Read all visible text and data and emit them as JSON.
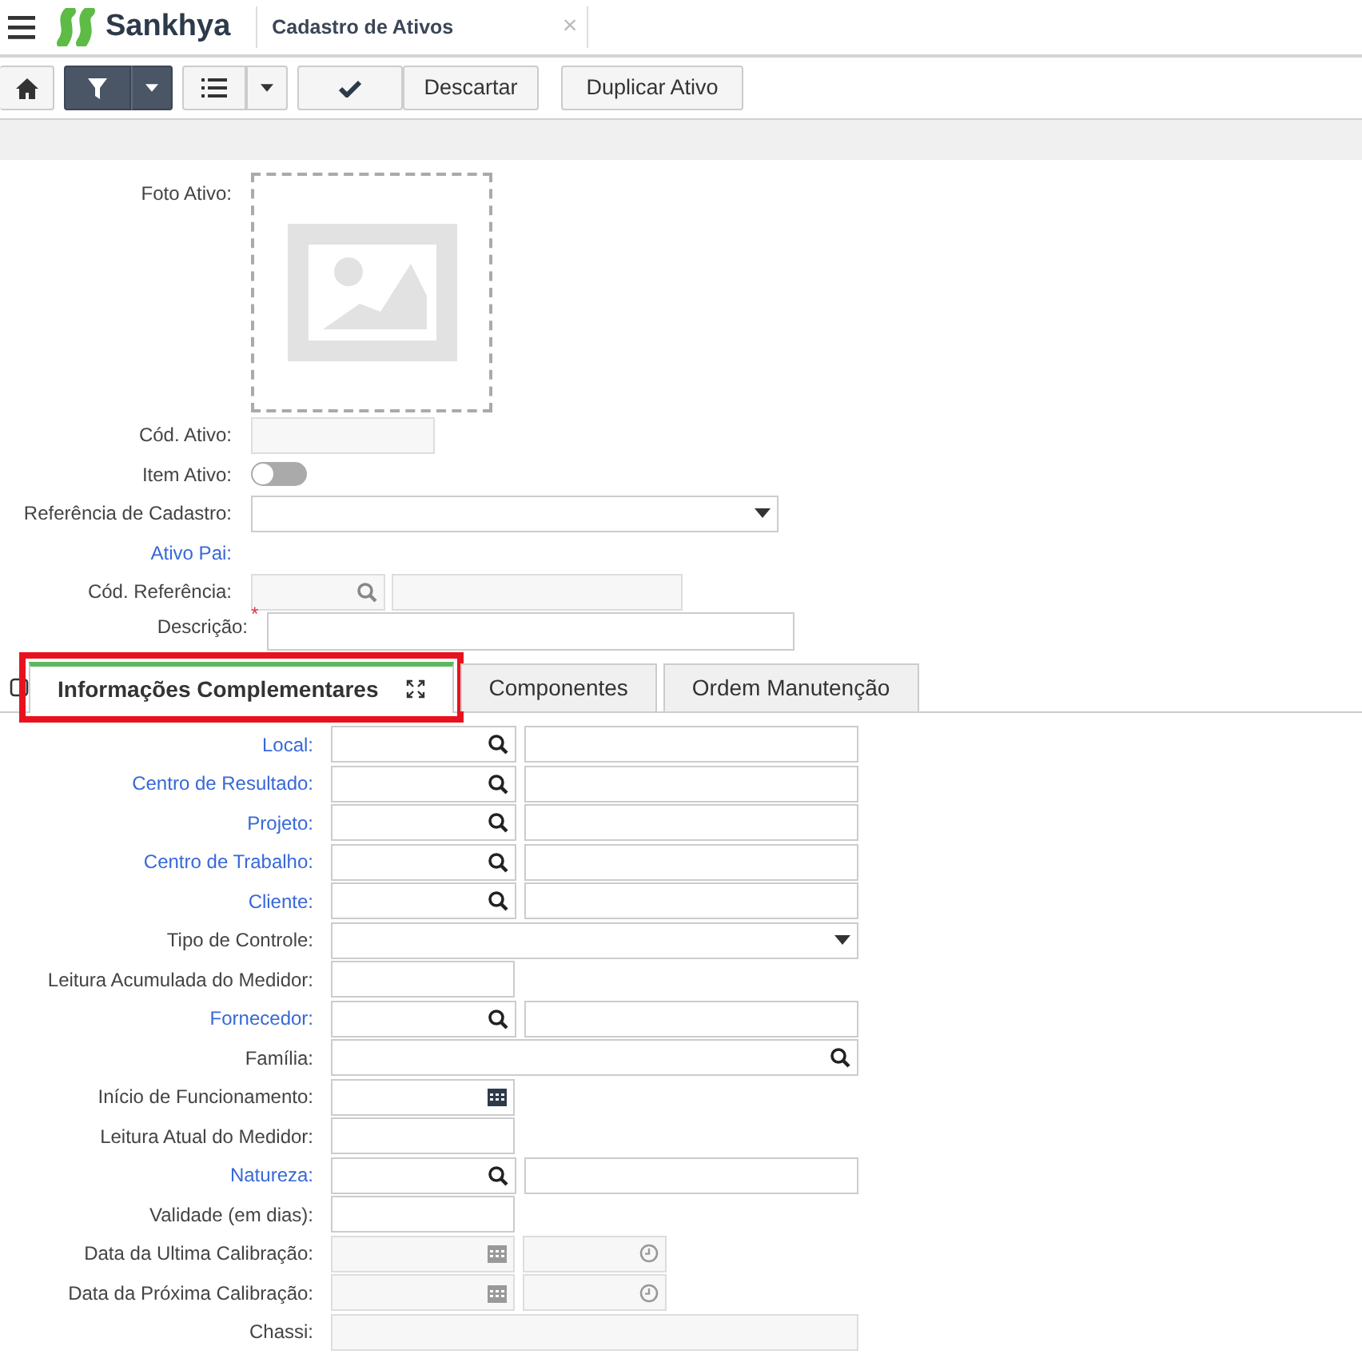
{
  "header": {
    "brand": "Sankhya",
    "tab_title": "Cadastro de Ativos",
    "close": "×"
  },
  "toolbar": {
    "buttons": [
      {
        "kind": "home"
      },
      {
        "kind": "filter",
        "dark": true
      },
      {
        "kind": "list",
        "dark": false
      },
      {
        "kind": "confirm",
        "label": "Descartar"
      },
      {
        "kind": "text",
        "label": "Duplicar Ativo"
      }
    ]
  },
  "top_fields": [
    {
      "kind": "photo",
      "label": "Foto Ativo:"
    },
    {
      "kind": "text",
      "label": "Cód. Ativo:",
      "disabled": true
    },
    {
      "kind": "switch",
      "label": "Item Ativo:",
      "on": false
    },
    {
      "kind": "select",
      "label": "Referência de Cadastro:"
    },
    {
      "kind": "heading",
      "label": "Ativo Pai:",
      "link": true
    },
    {
      "kind": "lookup",
      "label": "Cód. Referência:",
      "disabled": true
    },
    {
      "kind": "textarea",
      "label": "Descrição:",
      "required": true,
      "required_mark": "*"
    }
  ],
  "tabs": [
    {
      "label": "Informações Complementares",
      "selected": true,
      "highlighted": true
    },
    {
      "label": "Componentes",
      "selected": false,
      "highlighted": false
    },
    {
      "label": "Ordem Manutenção",
      "selected": false,
      "highlighted": false
    }
  ],
  "fields": [
    {
      "kind": "lookup",
      "label": "Local:",
      "link": true,
      "disabled": false
    },
    {
      "kind": "lookup",
      "label": "Centro de Resultado:",
      "link": true,
      "disabled": false
    },
    {
      "kind": "lookup",
      "label": "Projeto:",
      "link": true,
      "disabled": false
    },
    {
      "kind": "lookup",
      "label": "Centro de Trabalho:",
      "link": true,
      "disabled": false
    },
    {
      "kind": "lookup",
      "label": "Cliente:",
      "link": true,
      "disabled": false
    },
    {
      "kind": "select",
      "label": "Tipo de Controle:",
      "link": false,
      "disabled": false
    },
    {
      "kind": "text",
      "label": "Leitura Acumulada do Medidor:",
      "link": false,
      "disabled": false
    },
    {
      "kind": "lookup",
      "label": "Fornecedor:",
      "link": true,
      "disabled": false
    },
    {
      "kind": "search",
      "label": "Família:",
      "link": false,
      "disabled": false
    },
    {
      "kind": "date",
      "label": "Início de Funcionamento:",
      "link": false,
      "disabled": false
    },
    {
      "kind": "text",
      "label": "Leitura Atual do Medidor:",
      "link": false,
      "disabled": false
    },
    {
      "kind": "lookup",
      "label": "Natureza:",
      "link": true,
      "disabled": false
    },
    {
      "kind": "text",
      "label": "Validade (em dias):",
      "link": false,
      "disabled": false
    },
    {
      "kind": "datetime",
      "label": "Data da Ultima Calibração:",
      "link": false,
      "disabled": true
    },
    {
      "kind": "datetime",
      "label": "Data da Próxima Calibração:",
      "link": false,
      "disabled": true
    },
    {
      "kind": "wide",
      "label": "Chassi:",
      "link": false,
      "disabled": true
    }
  ]
}
